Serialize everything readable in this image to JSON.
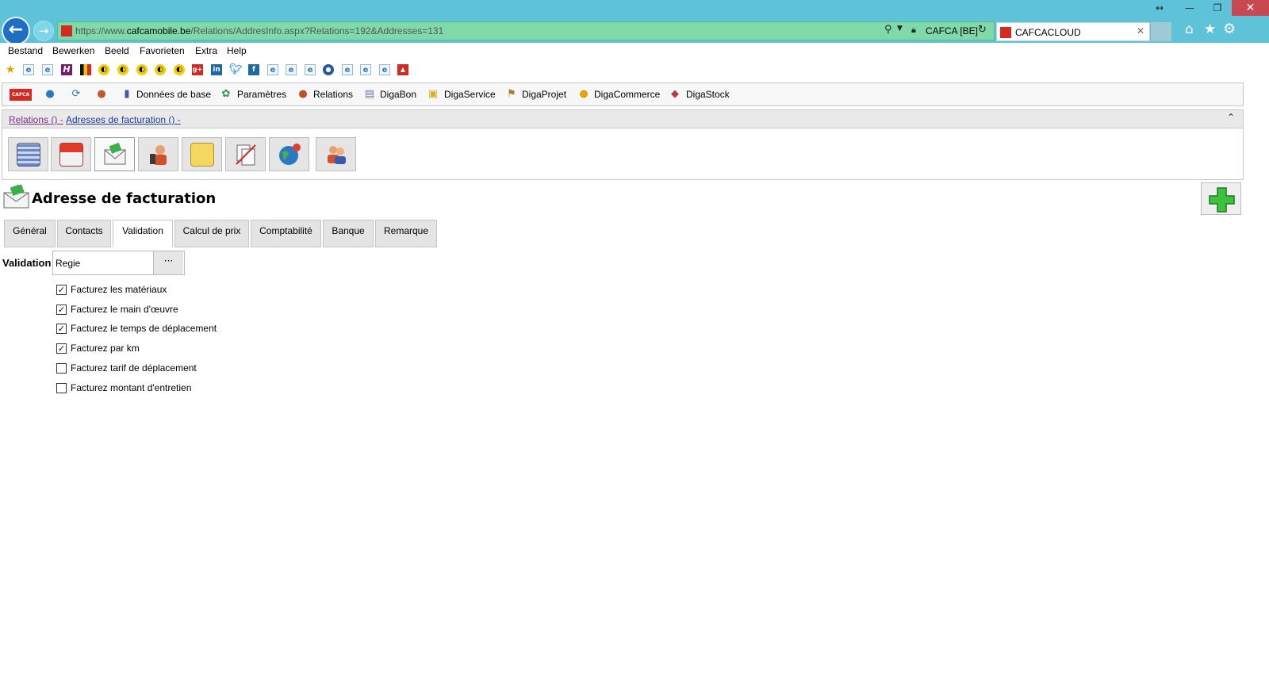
{
  "browser": {
    "url_prefix": "https://www.",
    "url_domain": "cafcamobile.be",
    "url_path": "/Relations/AddresInfo.aspx?Relations=192&Addresses=131",
    "cert_label": "CAFCA [BE]",
    "tab_title": "CAFCACLOUD"
  },
  "menu": [
    "Bestand",
    "Bewerken",
    "Beeld",
    "Favorieten",
    "Extra",
    "Help"
  ],
  "app_nav": {
    "logo_text": "CAFCA",
    "items": [
      "Données de base",
      "Paramètres",
      "Relations",
      "DigaBon",
      "DigaService",
      "DigaProjet",
      "DigaCommerce",
      "DigaStock"
    ]
  },
  "breadcrumb": {
    "part1": "Relations () -",
    "part2": "Adresses de facturation () -"
  },
  "page": {
    "title": "Adresse de facturation"
  },
  "tabs": [
    "Général",
    "Contacts",
    "Validation",
    "Calcul de prix",
    "Comptabilité",
    "Banque",
    "Remarque"
  ],
  "active_tab": "Validation",
  "form": {
    "validation_label": "Validation",
    "validation_value": "Regie",
    "browse_label": "···",
    "options": [
      {
        "label": "Facturez les matériaux",
        "checked": true
      },
      {
        "label": "Facturez le main d'œuvre",
        "checked": true
      },
      {
        "label": "Facturez le temps de déplacement",
        "checked": true
      },
      {
        "label": "Facturez par km",
        "checked": true
      },
      {
        "label": "Facturez tarif de déplacement",
        "checked": false
      },
      {
        "label": "Facturez montant d'entretien",
        "checked": false
      }
    ]
  },
  "colors": {
    "titlebar": "#5ec3d9",
    "addressbar": "#7fd9a8",
    "close": "#c7484f",
    "brand_red": "#d42a22",
    "add_green": "#3cc23c"
  }
}
